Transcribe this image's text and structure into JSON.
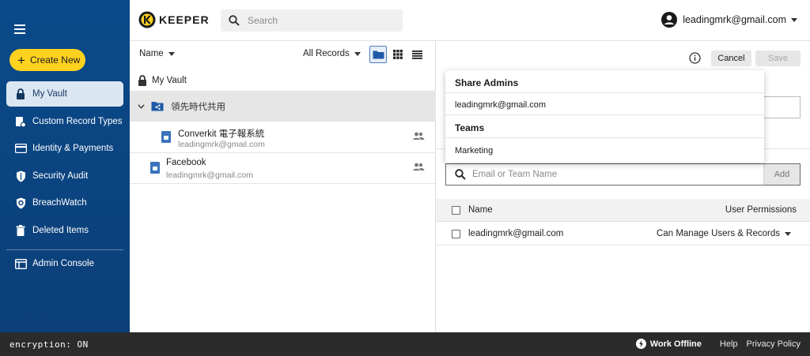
{
  "sidebar": {
    "create_label": "Create New",
    "items": [
      {
        "label": "My Vault",
        "icon": "lock-icon"
      },
      {
        "label": "Custom Record Types",
        "icon": "gear-doc-icon"
      },
      {
        "label": "Identity & Payments",
        "icon": "credit-card-icon"
      },
      {
        "label": "Security Audit",
        "icon": "shield-icon"
      },
      {
        "label": "BreachWatch",
        "icon": "breachwatch-icon"
      },
      {
        "label": "Deleted Items",
        "icon": "trash-icon"
      },
      {
        "label": "Admin Console",
        "icon": "console-icon"
      }
    ]
  },
  "header": {
    "logo_text": "KEEPER",
    "search_placeholder": "Search",
    "user_email": "leadingmrk@gmail.com"
  },
  "list": {
    "sort_label": "Name",
    "filter_label": "All Records",
    "my_vault": "My Vault",
    "folder_name": "領先時代共用",
    "records": [
      {
        "title": "Converkit 電子報系統",
        "sub": "leadingmrk@gmail.com"
      },
      {
        "title": "Facebook",
        "sub": "leadingmrk@gmail.com"
      }
    ]
  },
  "detail": {
    "cancel_label": "Cancel",
    "save_label": "Save",
    "add_placeholder": "Email or Team Name",
    "add_label": "Add",
    "col_name": "Name",
    "col_permissions": "User Permissions",
    "rows": [
      {
        "name": "leadingmrk@gmail.com",
        "permission": "Can Manage Users & Records"
      }
    ]
  },
  "dropdown": {
    "admins_heading": "Share Admins",
    "admin_email": "leadingmrk@gmail.com",
    "teams_heading": "Teams",
    "team_name": "Marketing"
  },
  "footer": {
    "encryption": "encryption: ON",
    "offline_label": "Work Offline",
    "help_label": "Help",
    "privacy_label": "Privacy Policy"
  },
  "colors": {
    "sidebar_bg": "#0c3f78",
    "accent_yellow": "#ffd21f",
    "record_icon_blue": "#3a74bc",
    "footer_bg": "#2b2b2b"
  }
}
